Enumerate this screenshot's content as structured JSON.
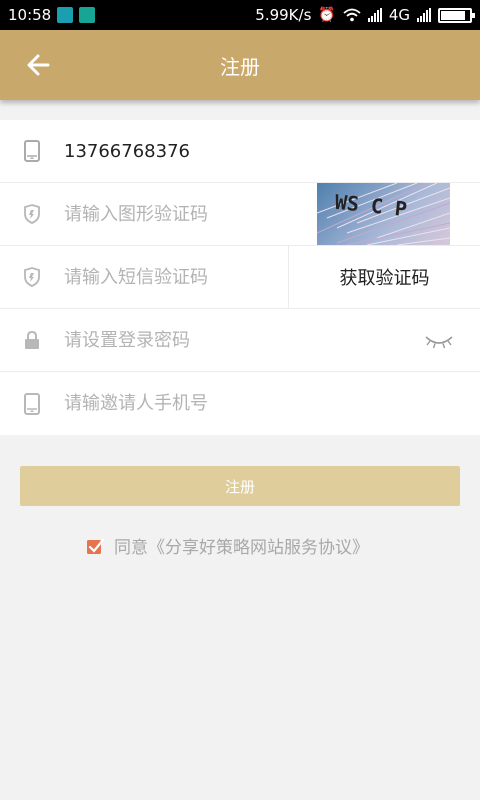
{
  "status_bar": {
    "time": "10:58",
    "net_speed": "5.99K/s",
    "network_type": "4G",
    "icons": [
      "screenshot-icon",
      "usb-icon",
      "alarm-icon",
      "wifi-icon",
      "signal-icon",
      "battery-icon"
    ],
    "battery_level_percent": 85
  },
  "app_bar": {
    "title": "注册",
    "back_icon": "arrow-left-icon"
  },
  "form": {
    "phone": {
      "value": "13766768376",
      "icon": "phone-icon"
    },
    "image_code": {
      "placeholder": "请输入图形验证码",
      "icon": "shield-icon",
      "captcha_text": "WS C P"
    },
    "sms_code": {
      "placeholder": "请输入短信验证码",
      "icon": "shield-icon",
      "button_label": "获取验证码"
    },
    "password": {
      "placeholder": "请设置登录密码",
      "icon": "lock-icon",
      "toggle_icon": "eye-closed-icon"
    },
    "inviter_phone": {
      "placeholder": "请输邀请人手机号",
      "icon": "phone-icon"
    }
  },
  "submit": {
    "label": "注册"
  },
  "agreement": {
    "checked": true,
    "text": "同意《分享好策略网站服务协议》"
  },
  "colors": {
    "app_bar": "#c9a86b",
    "submit_button": "#dfcd9b",
    "checkbox": "#e8734f",
    "background": "#f2f2f2"
  }
}
